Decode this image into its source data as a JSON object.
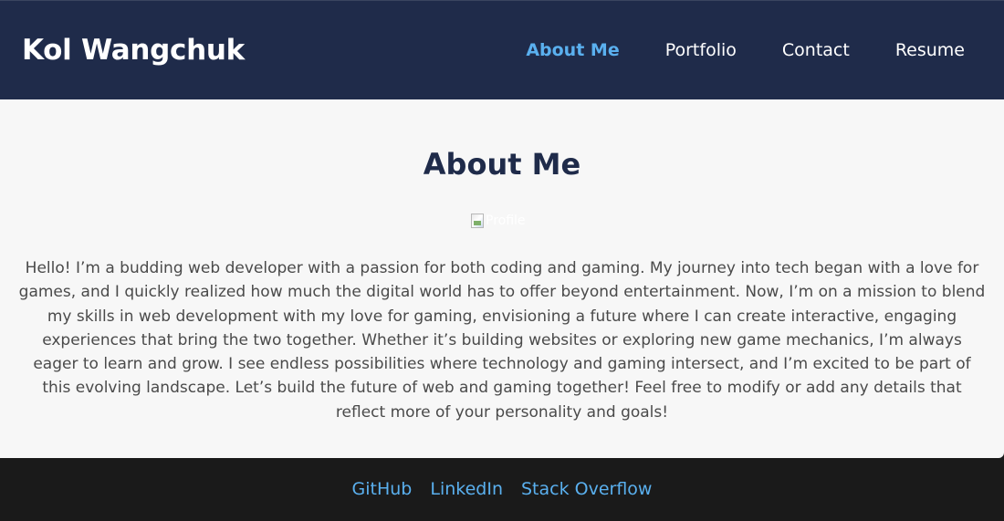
{
  "header": {
    "site_title": "Kol Wangchuk",
    "nav": [
      {
        "label": "About Me",
        "active": true
      },
      {
        "label": "Portfolio",
        "active": false
      },
      {
        "label": "Contact",
        "active": false
      },
      {
        "label": "Resume",
        "active": false
      }
    ]
  },
  "about": {
    "title": "About Me",
    "profile_image_alt": "Profile",
    "bio": "Hello! I’m a budding web developer with a passion for both coding and gaming. My journey into tech began with a love for games, and I quickly realized how much the digital world has to offer beyond entertainment. Now, I’m on a mission to blend my skills in web development with my love for gaming, envisioning a future where I can create interactive, engaging experiences that bring the two together. Whether it’s building websites or exploring new game mechanics, I’m always eager to learn and grow. I see endless possibilities where technology and gaming intersect, and I’m excited to be part of this evolving landscape. Let’s build the future of web and gaming together! Feel free to modify or add any details that reflect more of your personality and goals!"
  },
  "footer": {
    "links": [
      {
        "label": "GitHub"
      },
      {
        "label": "LinkedIn"
      },
      {
        "label": "Stack Overflow"
      }
    ]
  },
  "colors": {
    "header_bg": "#1f2b4a",
    "accent": "#5ab0ef",
    "main_bg": "#f7f7f7",
    "footer_bg": "#1a1a1a",
    "title_color": "#1f2b4a"
  }
}
